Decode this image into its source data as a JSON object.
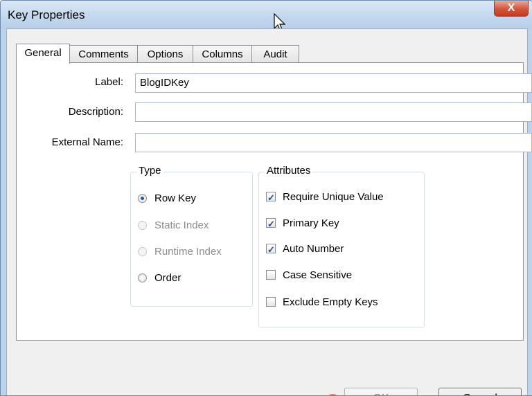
{
  "window": {
    "title": "Key Properties",
    "close_glyph": "X"
  },
  "tabs": [
    {
      "label": "General",
      "active": true
    },
    {
      "label": "Comments",
      "active": false
    },
    {
      "label": "Options",
      "active": false
    },
    {
      "label": "Columns",
      "active": false
    },
    {
      "label": "Audit",
      "active": false
    }
  ],
  "fields": {
    "label": {
      "label": "Label:",
      "value": "BlogIDKey"
    },
    "description": {
      "label": "Description:",
      "value": ""
    },
    "external_name": {
      "label": "External Name:",
      "value": ""
    }
  },
  "type_group": {
    "title": "Type",
    "options": [
      {
        "label": "Row Key",
        "selected": true,
        "enabled": true
      },
      {
        "label": "Static Index",
        "selected": false,
        "enabled": false
      },
      {
        "label": "Runtime Index",
        "selected": false,
        "enabled": false
      },
      {
        "label": "Order",
        "selected": false,
        "enabled": true
      }
    ]
  },
  "attributes_group": {
    "title": "Attributes",
    "options": [
      {
        "label": "Require Unique Value",
        "checked": true
      },
      {
        "label": "Primary Key",
        "checked": true
      },
      {
        "label": "Auto Number",
        "checked": true
      },
      {
        "label": "Case Sensitive",
        "checked": false
      },
      {
        "label": "Exclude Empty Keys",
        "checked": false
      }
    ]
  },
  "footer": {
    "warning_icon": "error-icon",
    "warning_glyph": "!",
    "ok_label": "OK",
    "ok_enabled": false,
    "cancel_label": "Cancel"
  },
  "colors": {
    "title_bar": "#c2d7ee",
    "close_button": "#d2553b",
    "radio_selected": "#1d5aa8",
    "warning": "#e2470f"
  }
}
